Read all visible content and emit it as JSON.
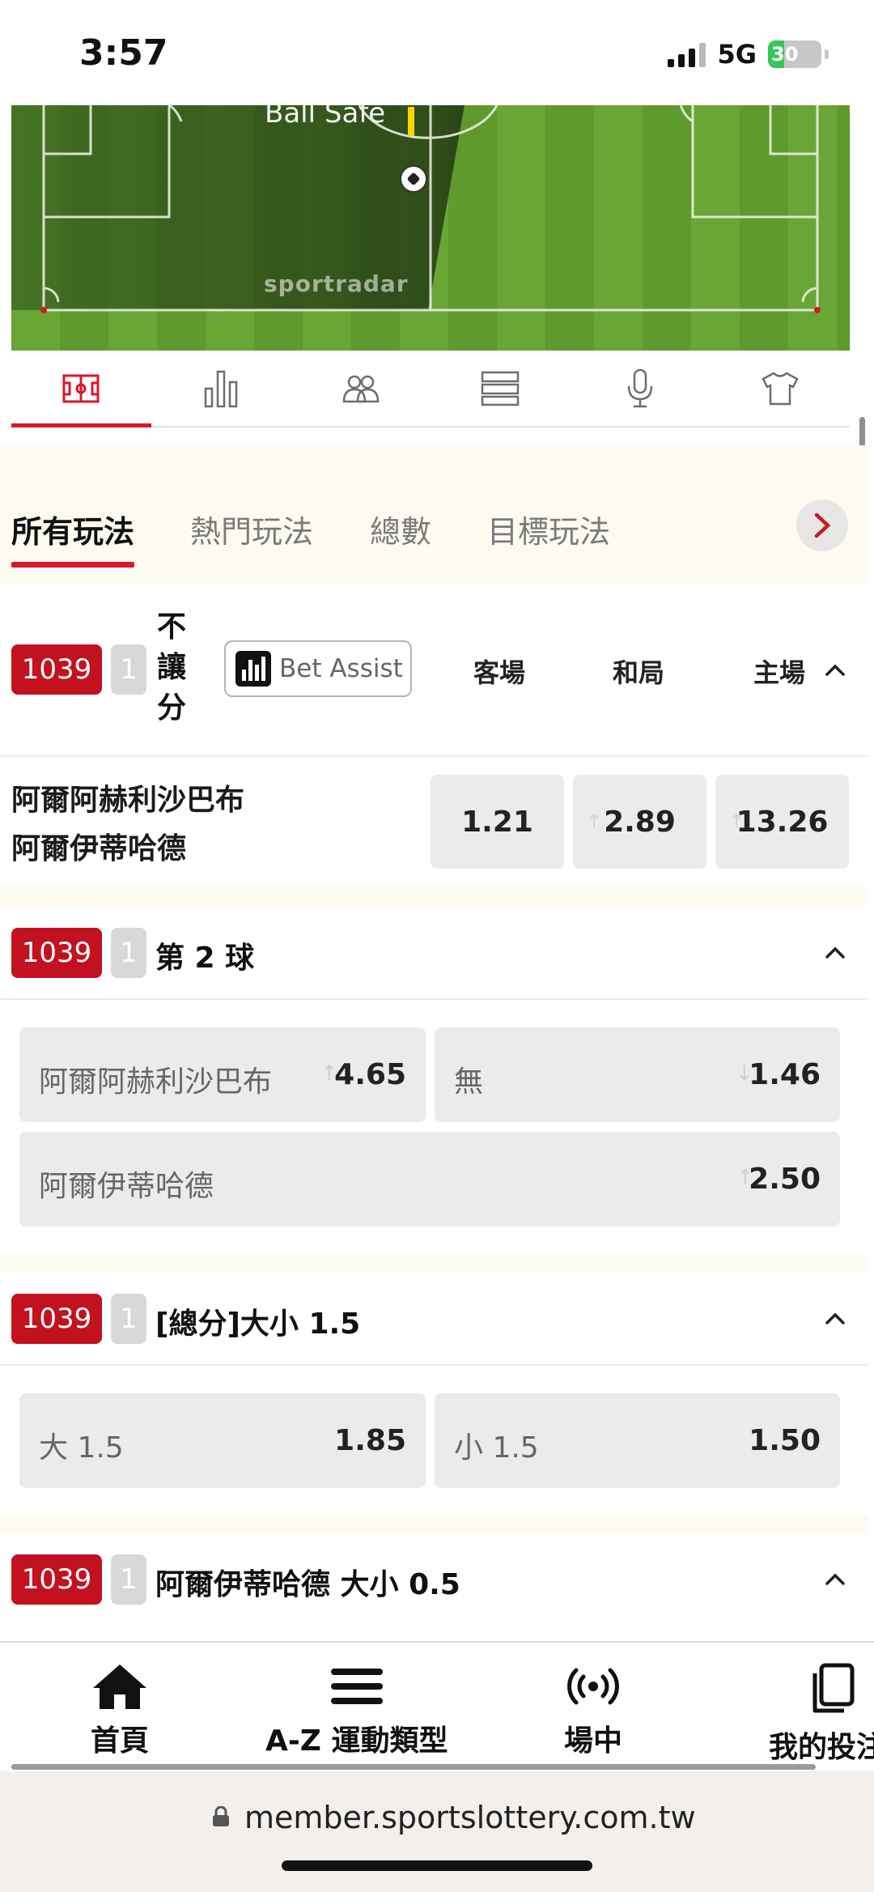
{
  "status_bar": {
    "time": "3:57",
    "network": "5G",
    "battery": "30",
    "battery_level": 0.3
  },
  "pitch": {
    "label": "Ball Safe",
    "watermark": "sportradar"
  },
  "tracker_tabs": [
    "pitch-icon",
    "stats-icon",
    "lineups-icon",
    "list-icon",
    "commentary-icon",
    "jersey-icon"
  ],
  "categories": {
    "tabs": [
      "所有玩法",
      "熱門玩法",
      "總數",
      "目標玩法"
    ],
    "active": 0
  },
  "markets": {
    "m1": {
      "code": "1039",
      "period": "1",
      "title": "不讓分",
      "title_chars": [
        "不",
        "讓",
        "分"
      ],
      "bet_assist": "Bet Assist",
      "columns": [
        "客場",
        "和局",
        "主場"
      ],
      "home_team": "阿爾阿赫利沙巴布",
      "away_team": "阿爾伊蒂哈德",
      "odds": [
        "1.21",
        "2.89",
        "13.26"
      ]
    },
    "m2": {
      "code": "1039",
      "period": "1",
      "title": "第 2 球",
      "selections": [
        {
          "label": "阿爾阿赫利沙巴布",
          "odds": "4.65"
        },
        {
          "label": "無",
          "odds": "1.46"
        },
        {
          "label": "阿爾伊蒂哈德",
          "odds": "2.50"
        }
      ]
    },
    "m3": {
      "code": "1039",
      "period": "1",
      "title": "[總分]大小 1.5",
      "selections": [
        {
          "label": "大 1.5",
          "odds": "1.85"
        },
        {
          "label": "小 1.5",
          "odds": "1.50"
        }
      ]
    },
    "m4": {
      "code": "1039",
      "period": "1",
      "title": "阿爾伊蒂哈德 大小 0.5"
    }
  },
  "bottom_nav": [
    {
      "label": "首頁",
      "icon": "home-icon"
    },
    {
      "label": "A-Z 運動類型",
      "icon": "menu-icon"
    },
    {
      "label": "場中",
      "icon": "live-icon"
    },
    {
      "label": "我的投注",
      "icon": "bets-icon"
    }
  ],
  "url": "member.sportslottery.com.tw"
}
